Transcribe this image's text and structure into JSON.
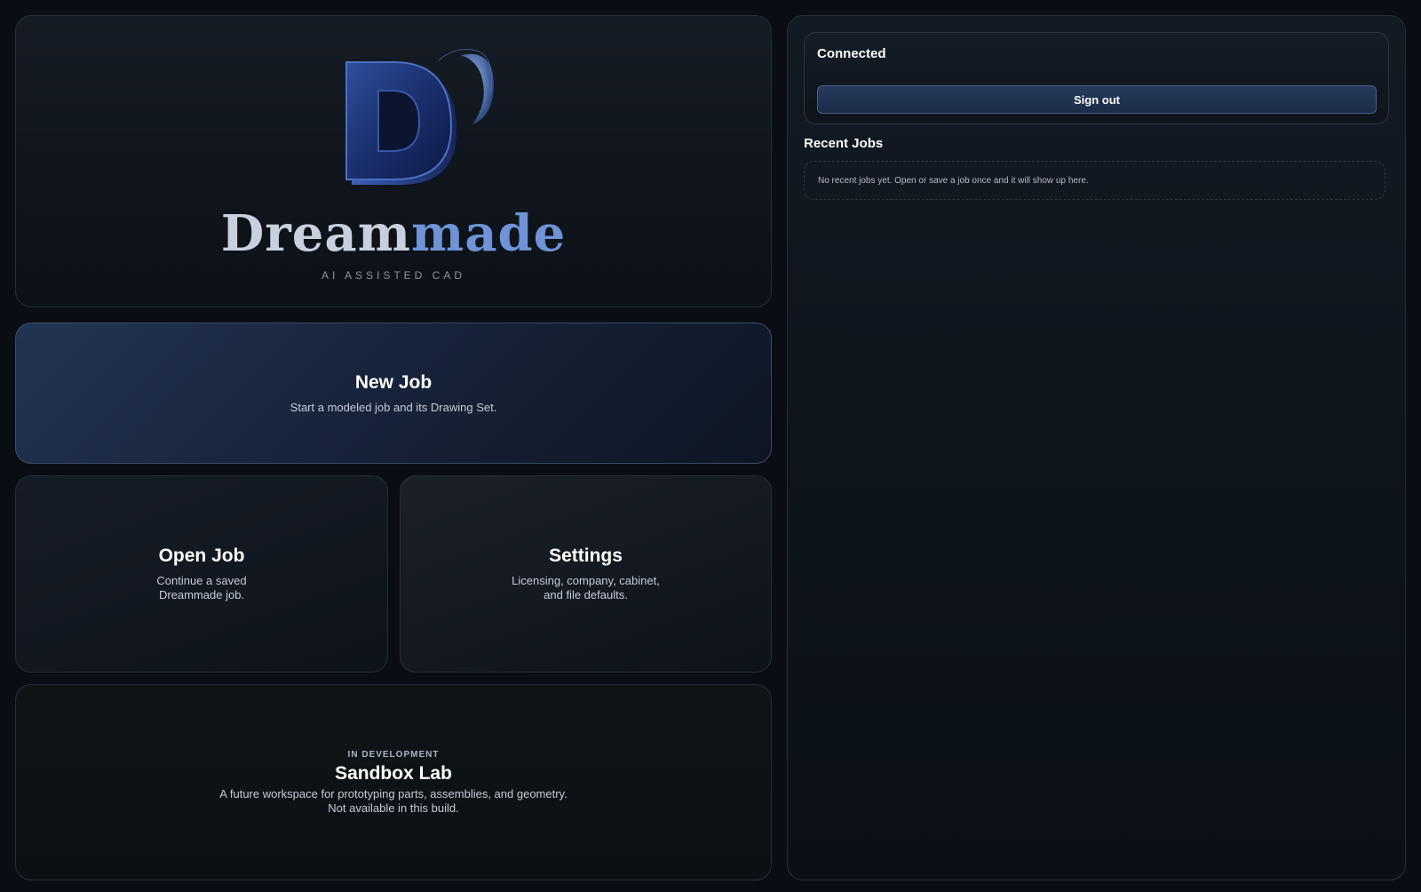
{
  "brand": {
    "name_part1": "Dream",
    "name_part2": "made",
    "tagline": "AI ASSISTED CAD",
    "accent": "#6e93d6"
  },
  "tiles": {
    "new_job": {
      "title": "New Job",
      "description": "Start a modeled job and its Drawing Set."
    },
    "open_job": {
      "title": "Open Job",
      "description": "Continue a saved\nDreammade job."
    },
    "settings": {
      "title": "Settings",
      "description": "Licensing, company, cabinet,\nand file defaults."
    },
    "sandbox": {
      "badge": "IN DEVELOPMENT",
      "title": "Sandbox Lab",
      "description": "A future workspace for prototyping parts, assemblies, and geometry.\nNot available in this build."
    }
  },
  "account": {
    "status": "Connected",
    "sign_out_label": "Sign out"
  },
  "recent_jobs": {
    "title": "Recent Jobs",
    "empty_message": "No recent jobs yet. Open or save a job once and it will show up here."
  },
  "icons": {
    "logo": "dreammade-d-moon-logo"
  }
}
